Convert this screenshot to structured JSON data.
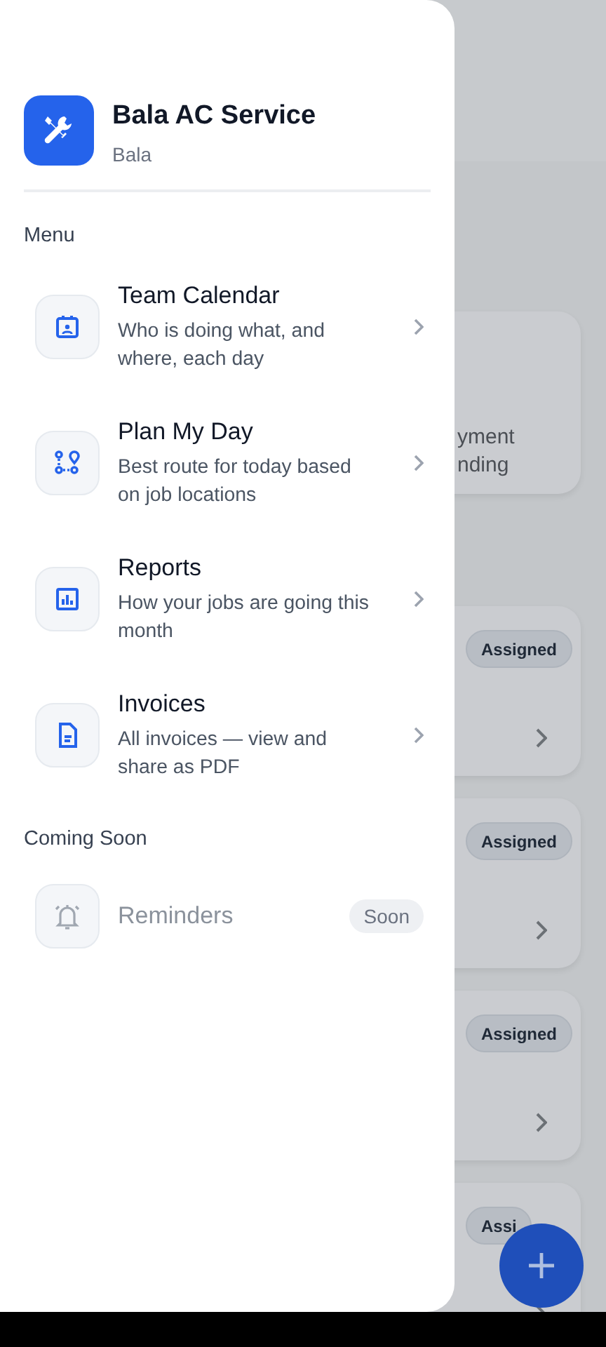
{
  "app": {
    "name": "Bala AC Service",
    "owner": "Bala"
  },
  "menu": {
    "heading": "Menu",
    "items": [
      {
        "kind": "calendar",
        "title": "Team Calendar",
        "subtitle": "Who is doing what, and where, each day"
      },
      {
        "kind": "route",
        "title": "Plan My Day",
        "subtitle": "Best route for today based on job locations"
      },
      {
        "kind": "chart",
        "title": "Reports",
        "subtitle": "How your jobs are going this month"
      },
      {
        "kind": "document",
        "title": "Invoices",
        "subtitle": "All invoices — view and share as PDF"
      }
    ]
  },
  "coming_soon": {
    "heading": "Coming Soon",
    "items": [
      {
        "kind": "bell",
        "title": "Reminders",
        "badge": "Soon",
        "disabled": true
      }
    ]
  },
  "background": {
    "summary_lines": [
      "yment",
      "nding"
    ],
    "jobs": [
      {
        "status": "Assigned"
      },
      {
        "status": "Assigned"
      },
      {
        "status": "Assigned"
      },
      {
        "status": "Assi"
      }
    ]
  }
}
